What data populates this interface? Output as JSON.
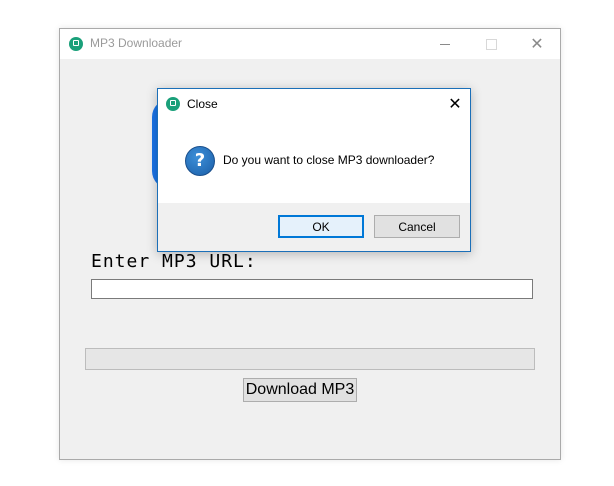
{
  "main_window": {
    "title": "MP3 Downloader",
    "controls": {
      "minimize_icon": "minimize-icon",
      "maximize_icon": "maximize-icon",
      "close_glyph": "✕"
    }
  },
  "form": {
    "url_label": "Enter MP3 URL:",
    "url_value": "",
    "url_placeholder": "",
    "progress": 0,
    "download_label": "Download MP3"
  },
  "dialog": {
    "title": "Close",
    "close_glyph": "✕",
    "icon": "question-icon",
    "icon_glyph": "?",
    "message": "Do you want to close MP3 downloader?",
    "ok_label": "OK",
    "cancel_label": "Cancel"
  },
  "colors": {
    "app_icon": "#1aa07a",
    "accent": "#0078d7",
    "logo_blue": "#1a73e8",
    "dialog_border": "#1b6fb8"
  }
}
